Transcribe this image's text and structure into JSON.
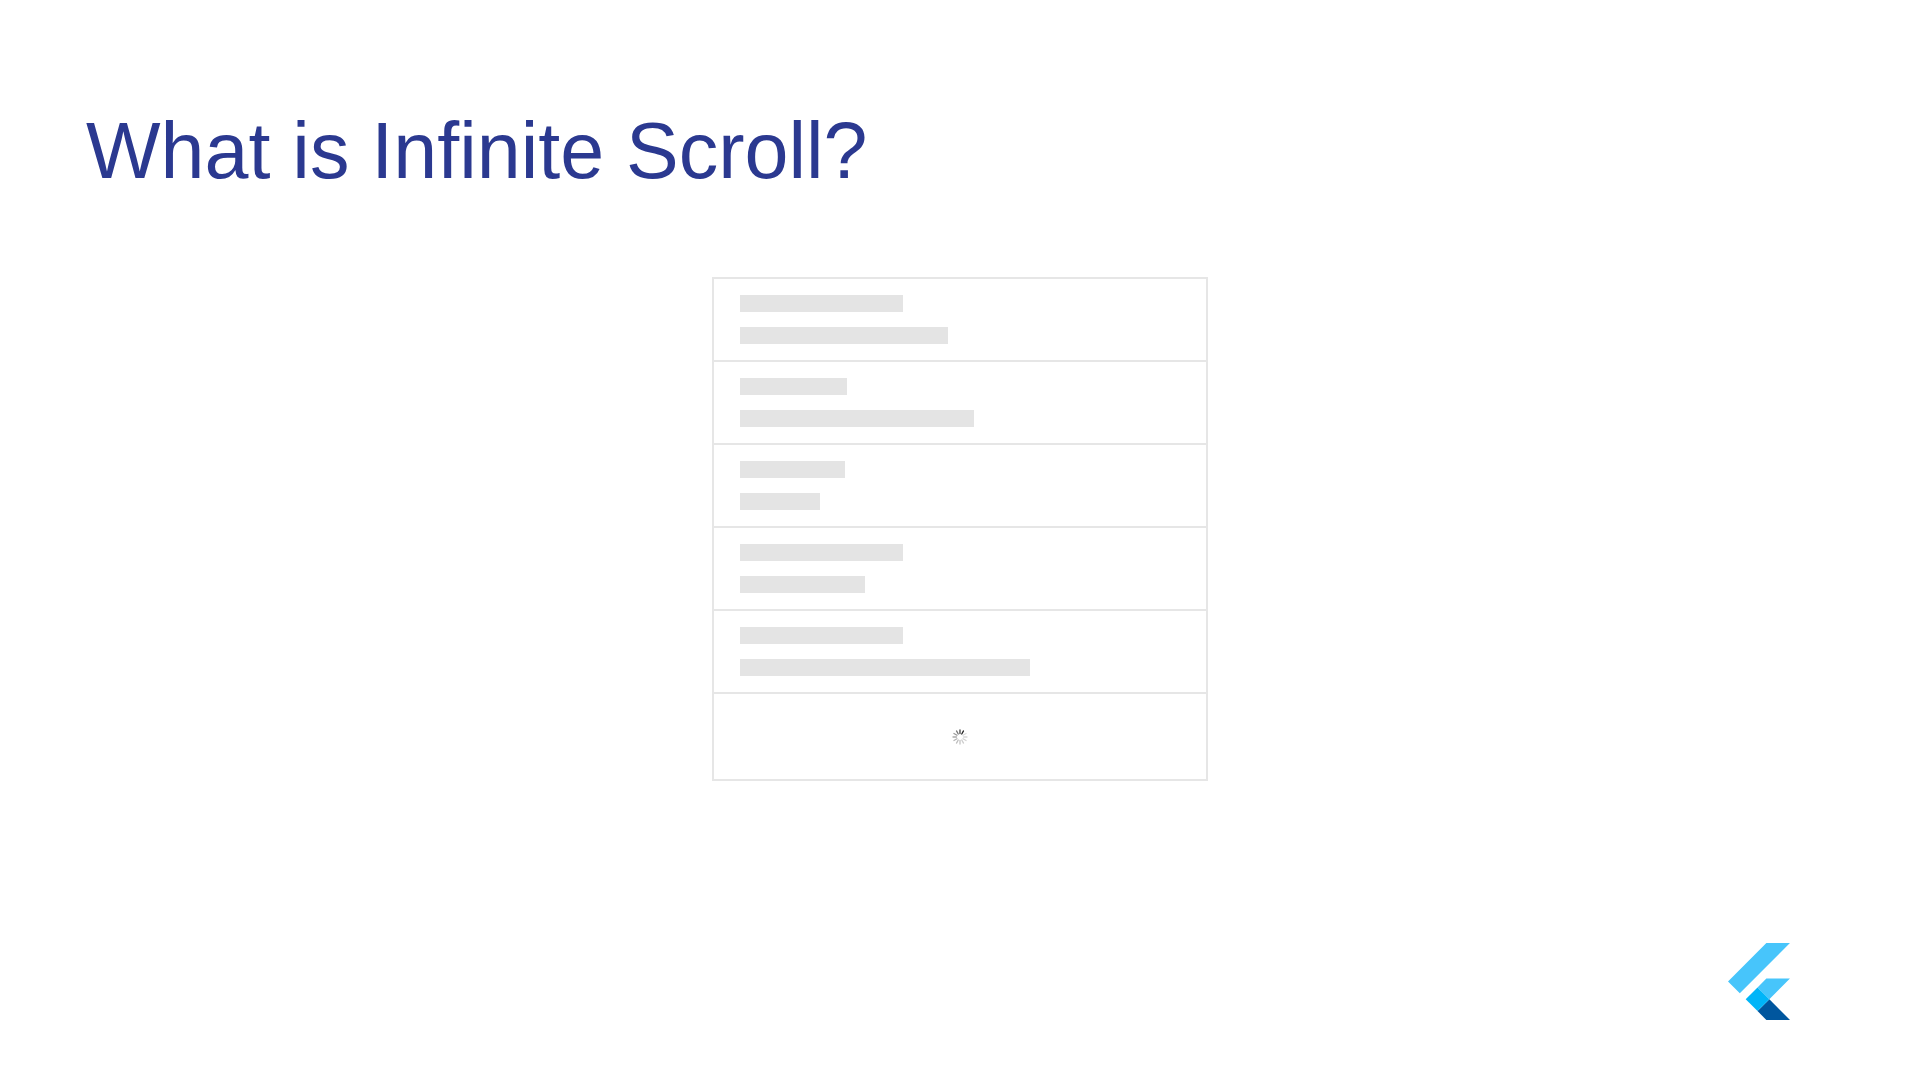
{
  "slide": {
    "title": "What is Infinite Scroll?"
  },
  "list": {
    "rows": [
      {
        "kind": "placeholder"
      },
      {
        "kind": "placeholder"
      },
      {
        "kind": "placeholder"
      },
      {
        "kind": "placeholder"
      },
      {
        "kind": "placeholder"
      },
      {
        "kind": "loading"
      }
    ]
  }
}
